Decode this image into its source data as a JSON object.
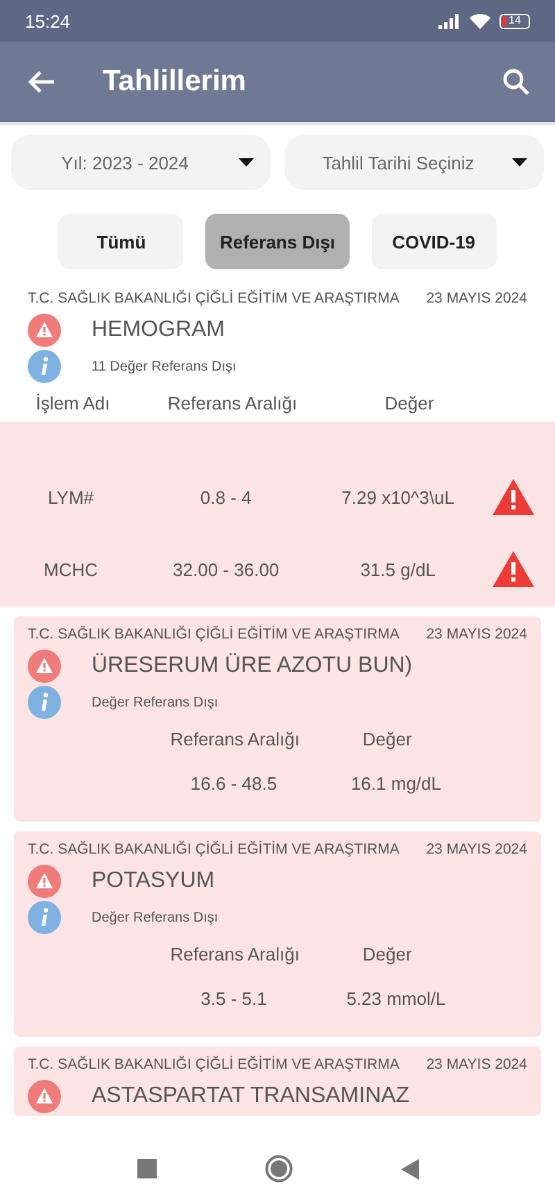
{
  "status_bar": {
    "time": "15:24",
    "battery": "14"
  },
  "app_bar": {
    "title": "Tahlillerim"
  },
  "filters": [
    {
      "label": "Yıl: 2023 - 2024"
    },
    {
      "label": "Tahlil Tarihi Seçiniz"
    }
  ],
  "tabs": [
    {
      "label": "Tümü",
      "selected": false
    },
    {
      "label": "Referans Dışı",
      "selected": true
    },
    {
      "label": "COVID-19",
      "selected": false
    }
  ],
  "results": [
    {
      "institution": "T.C. SAĞLIK BAKANLIĞI ÇİĞLİ EĞİTİM VE ARAŞTIRMA",
      "date": "23 MAYIS 2024",
      "name": "HEMOGRAM",
      "note": "11 Değer Referans Dışı",
      "expanded": true,
      "columns": [
        "İşlem Adı",
        "Referans Aralığı",
        "Değer"
      ],
      "rows": [
        {
          "cells": [
            "LYM#",
            "0.8 - 4",
            "7.29 x10^3\\uL"
          ],
          "flagged": true
        },
        {
          "cells": [
            "MCHC",
            "32.00 - 36.00",
            "31.5 g/dL"
          ],
          "flagged": true
        }
      ]
    },
    {
      "institution": "T.C. SAĞLIK BAKANLIĞI ÇİĞLİ EĞİTİM VE ARAŞTIRMA",
      "date": "23 MAYIS 2024",
      "name": "ÜRESERUM ÜRE AZOTU BUN)",
      "note": "Değer Referans Dışı",
      "expanded": false,
      "columns": [
        "Referans Aralığı",
        "Değer"
      ],
      "rows": [
        {
          "cells": [
            "16.6 - 48.5",
            "16.1 mg/dL"
          ],
          "flagged": false
        }
      ]
    },
    {
      "institution": "T.C. SAĞLIK BAKANLIĞI ÇİĞLİ EĞİTİM VE ARAŞTIRMA",
      "date": "23 MAYIS 2024",
      "name": "POTASYUM",
      "note": "Değer Referans Dışı",
      "expanded": false,
      "columns": [
        "Referans Aralığı",
        "Değer"
      ],
      "rows": [
        {
          "cells": [
            "3.5 - 5.1",
            "5.23 mmol/L"
          ],
          "flagged": false
        }
      ]
    },
    {
      "institution": "T.C. SAĞLIK BAKANLIĞI ÇİĞLİ EĞİTİM VE ARAŞTIRMA",
      "date": "23 MAYIS 2024",
      "name": "ASTASPARTAT TRANSAMINAZ",
      "expanded": false
    }
  ]
}
